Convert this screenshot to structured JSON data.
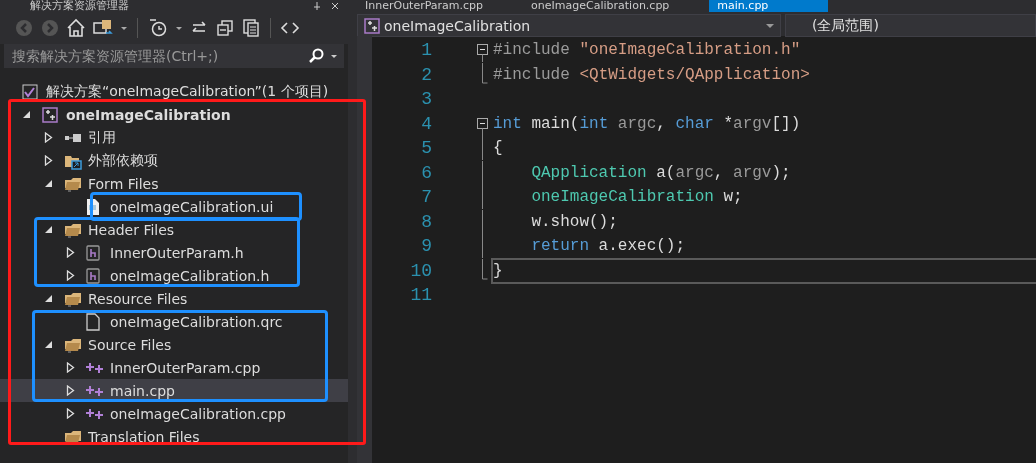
{
  "explorer": {
    "title": "解决方案资源管理器",
    "search": {
      "placeholder": "搜索解决方案资源管理器(Ctrl+;)"
    },
    "solution": {
      "label": "解决方案“oneImageCalibration”(1 个项目)"
    },
    "tree": [
      {
        "label": "oneImageCalibration",
        "kind": "project",
        "expanded": true,
        "selected": false,
        "children": [
          {
            "label": "引用",
            "kind": "references",
            "expanded": false,
            "selected": false
          },
          {
            "label": "外部依赖项",
            "kind": "external",
            "expanded": false,
            "selected": false
          },
          {
            "label": "Form Files",
            "kind": "folder",
            "expanded": true,
            "selected": false,
            "children": [
              {
                "label": "oneImageCalibration.ui",
                "kind": "ui",
                "selected": false
              }
            ]
          },
          {
            "label": "Header Files",
            "kind": "folder",
            "expanded": true,
            "selected": false,
            "children": [
              {
                "label": "InnerOuterParam.h",
                "kind": "header",
                "expanded": false,
                "selected": false
              },
              {
                "label": "oneImageCalibration.h",
                "kind": "header",
                "expanded": false,
                "selected": false
              }
            ]
          },
          {
            "label": "Resource Files",
            "kind": "folder",
            "expanded": true,
            "selected": false,
            "children": [
              {
                "label": "oneImageCalibration.qrc",
                "kind": "file",
                "selected": false
              }
            ]
          },
          {
            "label": "Source Files",
            "kind": "folder",
            "expanded": true,
            "selected": false,
            "children": [
              {
                "label": "InnerOuterParam.cpp",
                "kind": "cpp",
                "expanded": false,
                "selected": false
              },
              {
                "label": "main.cpp",
                "kind": "cpp",
                "expanded": false,
                "selected": true
              },
              {
                "label": "oneImageCalibration.cpp",
                "kind": "cpp",
                "expanded": false,
                "selected": false
              }
            ]
          },
          {
            "label": "Translation Files",
            "kind": "folder",
            "selected": false
          }
        ]
      }
    ]
  },
  "editor": {
    "tabs": [
      {
        "label": "InnerOuterParam.cpp",
        "selected": false
      },
      {
        "label": "oneImageCalibration.cpp",
        "selected": false
      },
      {
        "label": "main.cpp",
        "selected": true
      }
    ],
    "project_dropdown": "oneImageCalibration",
    "scope_dropdown": "(全局范围)",
    "lines": [
      {
        "number": "1",
        "collapsible": true,
        "fold_end": false,
        "current": false,
        "tokens": [
          {
            "text": "#include ",
            "kind": "preproc"
          },
          {
            "text": "\"oneImageCalibration.h\"",
            "kind": "string"
          }
        ]
      },
      {
        "number": "2",
        "collapsible": false,
        "fold_end": true,
        "current": false,
        "tokens": [
          {
            "text": "#include ",
            "kind": "preproc"
          },
          {
            "text": "<QtWidgets/QApplication>",
            "kind": "string"
          }
        ]
      },
      {
        "number": "3",
        "collapsible": false,
        "fold_end": false,
        "current": false
      },
      {
        "number": "4",
        "collapsible": true,
        "fold_end": false,
        "current": false,
        "tokens": [
          {
            "text": "int",
            "kind": "keyword"
          },
          {
            "text": " main(",
            "kind": "plain"
          },
          {
            "text": "int",
            "kind": "keyword"
          },
          {
            "text": " argc",
            "kind": "param"
          },
          {
            "text": ", ",
            "kind": "plain"
          },
          {
            "text": "char",
            "kind": "keyword"
          },
          {
            "text": " *",
            "kind": "plain"
          },
          {
            "text": "argv",
            "kind": "param"
          },
          {
            "text": "[])",
            "kind": "plain"
          }
        ]
      },
      {
        "number": "5",
        "collapsible": false,
        "fold_end": false,
        "current": false,
        "tokens": [
          {
            "text": "{",
            "kind": "plain"
          }
        ]
      },
      {
        "number": "6",
        "collapsible": false,
        "fold_end": false,
        "current": false,
        "tokens": [
          {
            "text": "    QApplication",
            "kind": "type"
          },
          {
            "text": " a(",
            "kind": "plain"
          },
          {
            "text": "argc",
            "kind": "param"
          },
          {
            "text": ", ",
            "kind": "plain"
          },
          {
            "text": "argv",
            "kind": "param"
          },
          {
            "text": ");",
            "kind": "plain"
          }
        ]
      },
      {
        "number": "7",
        "collapsible": false,
        "fold_end": false,
        "current": false,
        "tokens": [
          {
            "text": "    oneImageCalibration",
            "kind": "type"
          },
          {
            "text": " w;",
            "kind": "plain"
          }
        ]
      },
      {
        "number": "8",
        "collapsible": false,
        "fold_end": false,
        "current": false,
        "tokens": [
          {
            "text": "    w.show();",
            "kind": "plain"
          }
        ]
      },
      {
        "number": "9",
        "collapsible": false,
        "fold_end": false,
        "current": false,
        "tokens": [
          {
            "text": "    return",
            "kind": "keyword"
          },
          {
            "text": " a.exec();",
            "kind": "plain"
          }
        ]
      },
      {
        "number": "10",
        "collapsible": false,
        "fold_end": true,
        "current": true,
        "tokens": [
          {
            "text": "}",
            "kind": "plain"
          }
        ]
      },
      {
        "number": "11",
        "collapsible": false,
        "fold_end": false,
        "current": false
      }
    ]
  }
}
